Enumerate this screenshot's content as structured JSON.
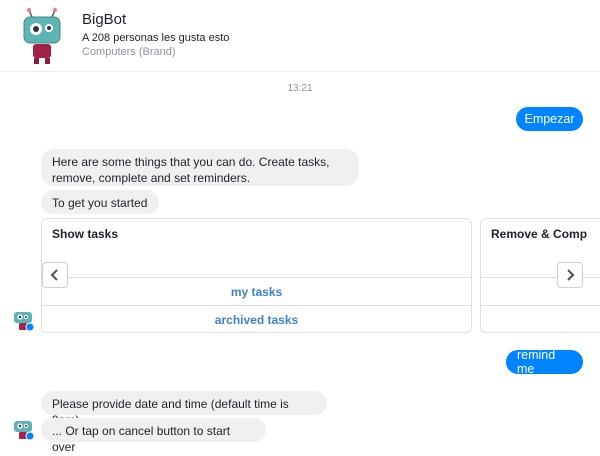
{
  "header": {
    "bot_name": "BigBot",
    "likes": "A 208 personas les gusta esto",
    "category": "Computers (Brand)"
  },
  "conversation": {
    "timestamp": "13:21",
    "user_msg_1": "Empezar",
    "bot_msg_1": "Here are some things that you can do. Create tasks, remove, complete and set reminders.",
    "bot_msg_2": "To get you started",
    "carousel": {
      "card_1": {
        "title": "Show tasks",
        "buttons": [
          "my tasks",
          "archived tasks"
        ]
      },
      "card_2": {
        "title": "Remove & Comp"
      }
    },
    "user_msg_2": "remind me",
    "bot_msg_3": "Please provide date and time (default time is 9am)",
    "bot_msg_4": "... Or tap on cancel button to start over"
  },
  "colors": {
    "messenger_blue": "#0084ff",
    "incoming_bubble": "#f1f0f0",
    "link_blue": "#4080c6"
  },
  "icons": [
    "robot-avatar-icon",
    "chevron-left-icon",
    "chevron-right-icon",
    "messenger-badge-icon"
  ]
}
